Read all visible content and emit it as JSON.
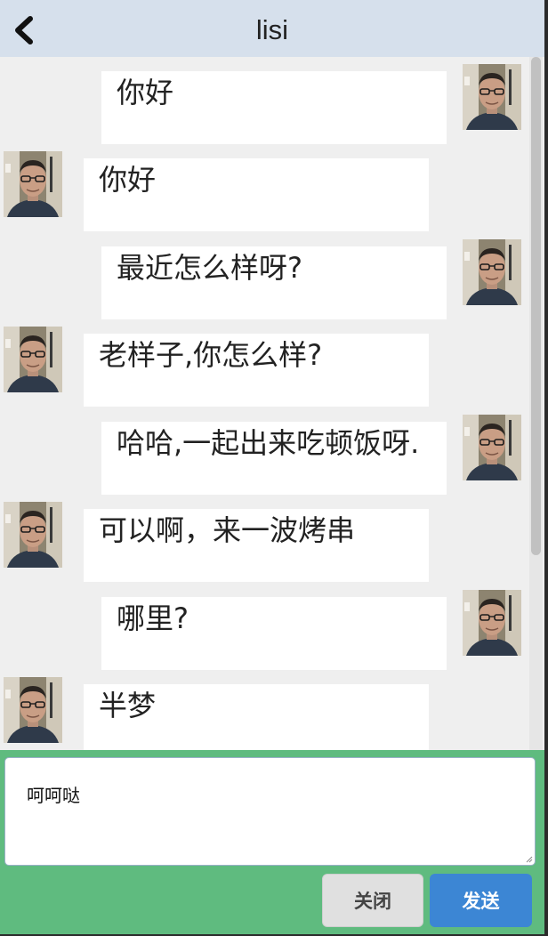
{
  "header": {
    "title": "lisi",
    "back_icon": "chevron-left-icon"
  },
  "messages": [
    {
      "side": "self",
      "text": "你好"
    },
    {
      "side": "other",
      "text": "你好"
    },
    {
      "side": "self",
      "text": "最近怎么样呀?"
    },
    {
      "side": "other",
      "text": "老样子,你怎么样?"
    },
    {
      "side": "self",
      "text": "哈哈,一起出来吃顿饭呀."
    },
    {
      "side": "other",
      "text": "可以啊，来一波烤串"
    },
    {
      "side": "self",
      "text": "哪里?"
    },
    {
      "side": "other",
      "text": "半梦"
    }
  ],
  "composer": {
    "input_value": "呵呵哒",
    "close_label": "关闭",
    "send_label": "发送"
  },
  "colors": {
    "header_bg": "#d6e0ec",
    "chat_bg": "#efefef",
    "composer_bg": "#5fbb7f",
    "send_button": "#3c86d4",
    "close_button": "#e0e0e0"
  }
}
